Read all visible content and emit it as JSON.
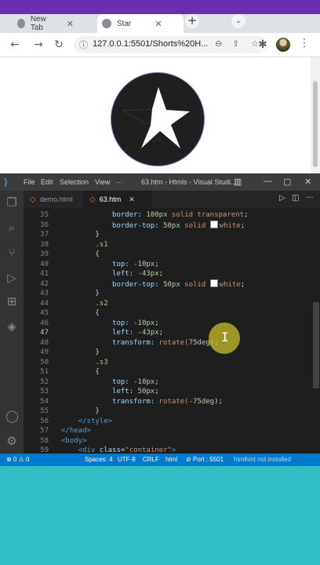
{
  "browser": {
    "tabs": [
      {
        "label": "New Tab",
        "close": "✕"
      },
      {
        "label": "Star",
        "close": "✕"
      }
    ],
    "newtab_symbol": "+",
    "dropdown_symbol": "⌄",
    "url": "127.0.0.1:5501/Shorts%20H...",
    "icons": [
      "back-icon",
      "forward-icon",
      "reload-icon",
      "info-icon",
      "zoom-icon",
      "share-icon",
      "bookmark-star-icon",
      "extensions-icon",
      "menu-icon"
    ]
  },
  "page": {
    "logo": "star-logo"
  },
  "vscode": {
    "menu": [
      "File",
      "Edit",
      "Selection",
      "View",
      "···"
    ],
    "window_title": "63.htm - Htmls - Visual Studi...",
    "tabs": [
      {
        "label": "demo.html",
        "active": false
      },
      {
        "label": "63.htm",
        "active": true
      }
    ],
    "tab_close": "✕",
    "line_numbers": [
      "35",
      "36",
      "37",
      "38",
      "39",
      "40",
      "41",
      "42",
      "43",
      "44",
      "45",
      "46",
      "47",
      "48",
      "49",
      "50",
      "51",
      "52",
      "53",
      "54",
      "55",
      "56",
      "57",
      "58",
      "59"
    ],
    "current_line": "47",
    "code_lines": [
      {
        "indent": 6,
        "tokens": [
          {
            "t": "border: ",
            "c": "prop"
          },
          {
            "t": "100px ",
            "c": "num"
          },
          {
            "t": "solid ",
            "c": "val"
          },
          {
            "t": "transparent",
            "c": "val"
          },
          {
            "t": ";",
            "c": "punc"
          }
        ]
      },
      {
        "indent": 6,
        "tokens": [
          {
            "t": "border-top: ",
            "c": "prop"
          },
          {
            "t": "50px ",
            "c": "num"
          },
          {
            "t": "solid ",
            "c": "val"
          },
          {
            "t": "white",
            "c": "val",
            "swatch": "#ffffff"
          },
          {
            "t": ";",
            "c": "punc"
          }
        ]
      },
      {
        "indent": 4,
        "tokens": [
          {
            "t": "}",
            "c": "punc"
          }
        ]
      },
      {
        "indent": 4,
        "tokens": [
          {
            "t": ".s1",
            "c": "sel"
          }
        ]
      },
      {
        "indent": 4,
        "tokens": [
          {
            "t": "{",
            "c": "punc"
          }
        ]
      },
      {
        "indent": 6,
        "tokens": [
          {
            "t": "top: ",
            "c": "prop"
          },
          {
            "t": "-10px",
            "c": "num"
          },
          {
            "t": ";",
            "c": "punc"
          }
        ]
      },
      {
        "indent": 6,
        "tokens": [
          {
            "t": "left: ",
            "c": "prop"
          },
          {
            "t": "-43px",
            "c": "num"
          },
          {
            "t": ";",
            "c": "punc"
          }
        ]
      },
      {
        "indent": 6,
        "tokens": [
          {
            "t": "border-top: ",
            "c": "prop"
          },
          {
            "t": "50px ",
            "c": "num"
          },
          {
            "t": "solid ",
            "c": "val"
          },
          {
            "t": "white",
            "c": "val",
            "swatch": "#ffffff"
          },
          {
            "t": ";",
            "c": "punc"
          }
        ]
      },
      {
        "indent": 4,
        "tokens": [
          {
            "t": "}",
            "c": "punc"
          }
        ]
      },
      {
        "indent": 4,
        "tokens": [
          {
            "t": ".s2",
            "c": "sel"
          }
        ]
      },
      {
        "indent": 4,
        "tokens": [
          {
            "t": "{",
            "c": "punc"
          }
        ]
      },
      {
        "indent": 6,
        "tokens": [
          {
            "t": "top: ",
            "c": "prop"
          },
          {
            "t": "-10px",
            "c": "num"
          },
          {
            "t": ";",
            "c": "punc"
          }
        ]
      },
      {
        "indent": 6,
        "tokens": [
          {
            "t": "left: ",
            "c": "prop"
          },
          {
            "t": "-43px",
            "c": "num"
          },
          {
            "t": ";",
            "c": "punc"
          }
        ]
      },
      {
        "indent": 6,
        "tokens": [
          {
            "t": "transform: ",
            "c": "prop"
          },
          {
            "t": "rotate(",
            "c": "val"
          },
          {
            "t": "75deg",
            "c": "num"
          },
          {
            "t": ");",
            "c": "punc"
          }
        ]
      },
      {
        "indent": 4,
        "tokens": [
          {
            "t": "}",
            "c": "punc"
          }
        ]
      },
      {
        "indent": 4,
        "tokens": [
          {
            "t": ".s3",
            "c": "sel"
          }
        ]
      },
      {
        "indent": 4,
        "tokens": [
          {
            "t": "{",
            "c": "punc"
          }
        ]
      },
      {
        "indent": 6,
        "tokens": [
          {
            "t": "top: ",
            "c": "prop"
          },
          {
            "t": "-10px",
            "c": "num"
          },
          {
            "t": ";",
            "c": "punc"
          }
        ]
      },
      {
        "indent": 6,
        "tokens": [
          {
            "t": "left: ",
            "c": "prop"
          },
          {
            "t": "50px",
            "c": "num"
          },
          {
            "t": ";",
            "c": "punc"
          }
        ]
      },
      {
        "indent": 6,
        "tokens": [
          {
            "t": "transform: ",
            "c": "prop"
          },
          {
            "t": "rotate(",
            "c": "val"
          },
          {
            "t": "-75deg",
            "c": "num"
          },
          {
            "t": ");",
            "c": "punc"
          }
        ]
      },
      {
        "indent": 4,
        "tokens": [
          {
            "t": "}",
            "c": "punc"
          }
        ]
      },
      {
        "indent": 2,
        "tokens": [
          {
            "t": "</",
            "c": "tag"
          },
          {
            "t": "style",
            "c": "tag"
          },
          {
            "t": ">",
            "c": "tag"
          }
        ]
      },
      {
        "indent": 0,
        "tokens": [
          {
            "t": "</",
            "c": "tag"
          },
          {
            "t": "head",
            "c": "tag"
          },
          {
            "t": ">",
            "c": "tag"
          }
        ]
      },
      {
        "indent": 0,
        "tokens": [
          {
            "t": "<",
            "c": "tag"
          },
          {
            "t": "body",
            "c": "tag"
          },
          {
            "t": ">",
            "c": "tag"
          }
        ]
      },
      {
        "indent": 2,
        "tokens": [
          {
            "t": "<",
            "c": "tag"
          },
          {
            "t": "div ",
            "c": "tag"
          },
          {
            "t": "class",
            "c": "attr"
          },
          {
            "t": "=",
            "c": "punc"
          },
          {
            "t": "\"container\"",
            "c": "str"
          },
          {
            "t": ">",
            "c": "tag"
          }
        ]
      }
    ],
    "status": {
      "problems": "⊗ 0 ⚠ 0",
      "spaces": "Spaces: 4",
      "encoding": "UTF-8",
      "eol": "CRLF",
      "language": "html",
      "port": "⊘ Port : 5501",
      "linter": "htmlhint not installed"
    }
  },
  "colors": {
    "browser_top": "#6a2fb0",
    "teal": "#2fbfc4",
    "statusbar": "#007acc"
  }
}
